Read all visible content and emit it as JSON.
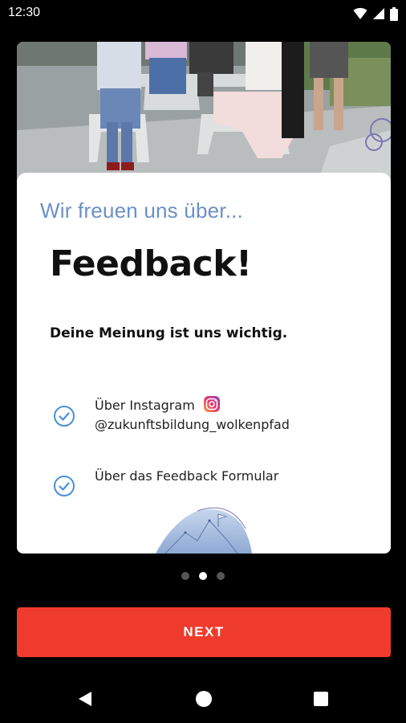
{
  "status_bar": {
    "time": "12:30",
    "icons": [
      "wifi-icon",
      "signal-icon",
      "battery-icon"
    ]
  },
  "card": {
    "subtitle": "Wir freuen uns über...",
    "title": "Feedback!",
    "tagline": "Deine Meinung ist uns wichtig.",
    "options": [
      {
        "line1": "Über Instagram",
        "line2": "@zukunftsbildung_wolkenpfad",
        "icon": "instagram-icon"
      },
      {
        "line1": "Über das Feedback Formular"
      }
    ]
  },
  "pager": {
    "count": 3,
    "active_index": 1
  },
  "next_button": {
    "label": "NEXT"
  },
  "nav": {
    "buttons": [
      "back",
      "home",
      "recents"
    ]
  },
  "colors": {
    "accent_red": "#ef3b2c",
    "subtitle_blue": "#6b90c4",
    "check_blue": "#4a8fdc"
  }
}
